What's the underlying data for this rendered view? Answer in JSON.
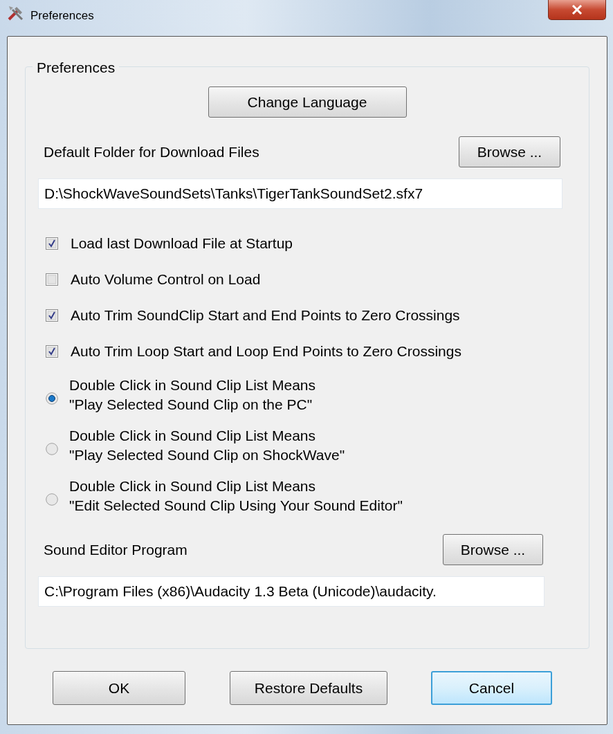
{
  "window": {
    "title": "Preferences"
  },
  "group": {
    "title": "Preferences"
  },
  "change_language_button": "Change Language",
  "download_folder": {
    "label": "Default Folder for Download Files",
    "browse": "Browse ...",
    "value": "D:\\ShockWaveSoundSets\\Tanks\\TigerTankSoundSet2.sfx7"
  },
  "checkboxes": [
    {
      "label": "Load last Download File at Startup",
      "checked": true
    },
    {
      "label": "Auto Volume Control on Load",
      "checked": false
    },
    {
      "label": "Auto Trim SoundClip Start and End Points to Zero Crossings",
      "checked": true
    },
    {
      "label": "Auto Trim Loop Start and Loop End Points to Zero Crossings",
      "checked": true
    }
  ],
  "radios": [
    {
      "lines": [
        "Double Click in Sound Clip List Means",
        "\"Play Selected Sound Clip on the PC\""
      ],
      "selected": true
    },
    {
      "lines": [
        "Double Click in Sound Clip List Means",
        "\"Play Selected Sound Clip on ShockWave\""
      ],
      "selected": false
    },
    {
      "lines": [
        "Double Click in Sound Clip List Means",
        "\"Edit Selected Sound Clip Using Your Sound Editor\""
      ],
      "selected": false
    }
  ],
  "sound_editor": {
    "label": "Sound Editor Program",
    "browse": "Browse ...",
    "value": "C:\\Program Files (x86)\\Audacity 1.3 Beta (Unicode)\\audacity."
  },
  "buttons": [
    {
      "label": "OK",
      "focused": false
    },
    {
      "label": "Restore Defaults",
      "focused": false
    },
    {
      "label": "Cancel",
      "focused": true
    }
  ]
}
